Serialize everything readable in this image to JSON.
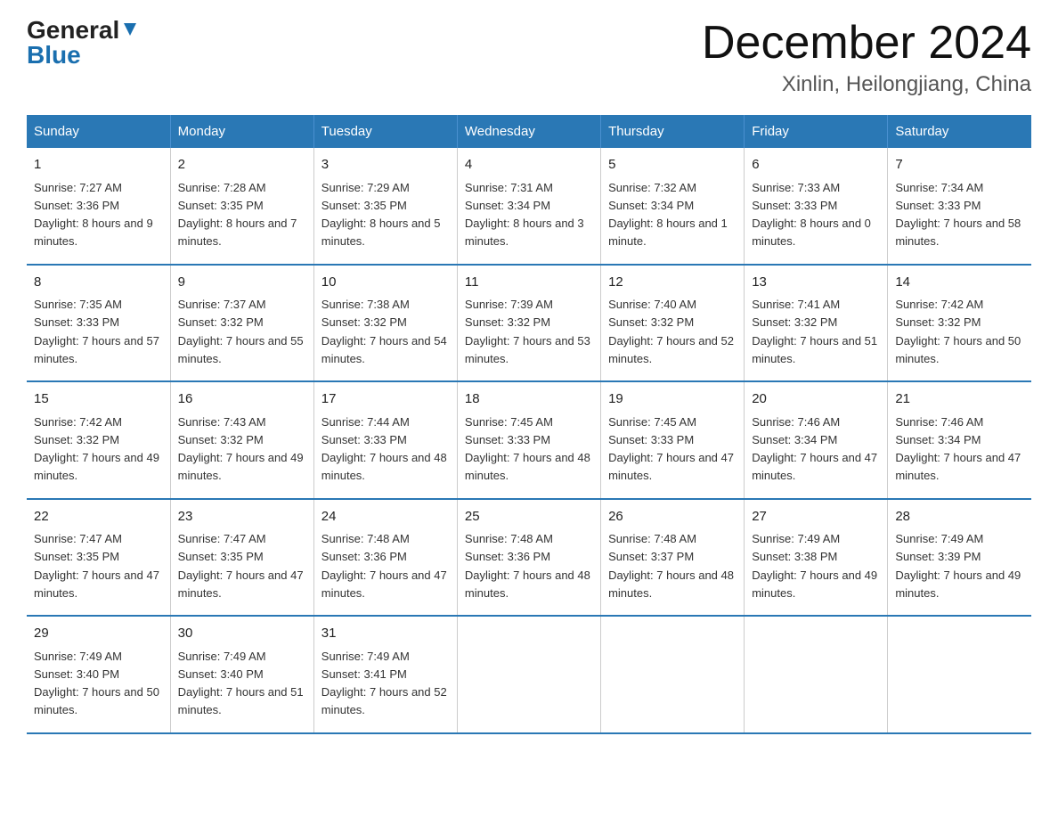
{
  "logo": {
    "general": "General",
    "blue": "Blue"
  },
  "title": "December 2024",
  "subtitle": "Xinlin, Heilongjiang, China",
  "days_of_week": [
    "Sunday",
    "Monday",
    "Tuesday",
    "Wednesday",
    "Thursday",
    "Friday",
    "Saturday"
  ],
  "weeks": [
    [
      {
        "day": "1",
        "sunrise": "7:27 AM",
        "sunset": "3:36 PM",
        "daylight": "8 hours and 9 minutes."
      },
      {
        "day": "2",
        "sunrise": "7:28 AM",
        "sunset": "3:35 PM",
        "daylight": "8 hours and 7 minutes."
      },
      {
        "day": "3",
        "sunrise": "7:29 AM",
        "sunset": "3:35 PM",
        "daylight": "8 hours and 5 minutes."
      },
      {
        "day": "4",
        "sunrise": "7:31 AM",
        "sunset": "3:34 PM",
        "daylight": "8 hours and 3 minutes."
      },
      {
        "day": "5",
        "sunrise": "7:32 AM",
        "sunset": "3:34 PM",
        "daylight": "8 hours and 1 minute."
      },
      {
        "day": "6",
        "sunrise": "7:33 AM",
        "sunset": "3:33 PM",
        "daylight": "8 hours and 0 minutes."
      },
      {
        "day": "7",
        "sunrise": "7:34 AM",
        "sunset": "3:33 PM",
        "daylight": "7 hours and 58 minutes."
      }
    ],
    [
      {
        "day": "8",
        "sunrise": "7:35 AM",
        "sunset": "3:33 PM",
        "daylight": "7 hours and 57 minutes."
      },
      {
        "day": "9",
        "sunrise": "7:37 AM",
        "sunset": "3:32 PM",
        "daylight": "7 hours and 55 minutes."
      },
      {
        "day": "10",
        "sunrise": "7:38 AM",
        "sunset": "3:32 PM",
        "daylight": "7 hours and 54 minutes."
      },
      {
        "day": "11",
        "sunrise": "7:39 AM",
        "sunset": "3:32 PM",
        "daylight": "7 hours and 53 minutes."
      },
      {
        "day": "12",
        "sunrise": "7:40 AM",
        "sunset": "3:32 PM",
        "daylight": "7 hours and 52 minutes."
      },
      {
        "day": "13",
        "sunrise": "7:41 AM",
        "sunset": "3:32 PM",
        "daylight": "7 hours and 51 minutes."
      },
      {
        "day": "14",
        "sunrise": "7:42 AM",
        "sunset": "3:32 PM",
        "daylight": "7 hours and 50 minutes."
      }
    ],
    [
      {
        "day": "15",
        "sunrise": "7:42 AM",
        "sunset": "3:32 PM",
        "daylight": "7 hours and 49 minutes."
      },
      {
        "day": "16",
        "sunrise": "7:43 AM",
        "sunset": "3:32 PM",
        "daylight": "7 hours and 49 minutes."
      },
      {
        "day": "17",
        "sunrise": "7:44 AM",
        "sunset": "3:33 PM",
        "daylight": "7 hours and 48 minutes."
      },
      {
        "day": "18",
        "sunrise": "7:45 AM",
        "sunset": "3:33 PM",
        "daylight": "7 hours and 48 minutes."
      },
      {
        "day": "19",
        "sunrise": "7:45 AM",
        "sunset": "3:33 PM",
        "daylight": "7 hours and 47 minutes."
      },
      {
        "day": "20",
        "sunrise": "7:46 AM",
        "sunset": "3:34 PM",
        "daylight": "7 hours and 47 minutes."
      },
      {
        "day": "21",
        "sunrise": "7:46 AM",
        "sunset": "3:34 PM",
        "daylight": "7 hours and 47 minutes."
      }
    ],
    [
      {
        "day": "22",
        "sunrise": "7:47 AM",
        "sunset": "3:35 PM",
        "daylight": "7 hours and 47 minutes."
      },
      {
        "day": "23",
        "sunrise": "7:47 AM",
        "sunset": "3:35 PM",
        "daylight": "7 hours and 47 minutes."
      },
      {
        "day": "24",
        "sunrise": "7:48 AM",
        "sunset": "3:36 PM",
        "daylight": "7 hours and 47 minutes."
      },
      {
        "day": "25",
        "sunrise": "7:48 AM",
        "sunset": "3:36 PM",
        "daylight": "7 hours and 48 minutes."
      },
      {
        "day": "26",
        "sunrise": "7:48 AM",
        "sunset": "3:37 PM",
        "daylight": "7 hours and 48 minutes."
      },
      {
        "day": "27",
        "sunrise": "7:49 AM",
        "sunset": "3:38 PM",
        "daylight": "7 hours and 49 minutes."
      },
      {
        "day": "28",
        "sunrise": "7:49 AM",
        "sunset": "3:39 PM",
        "daylight": "7 hours and 49 minutes."
      }
    ],
    [
      {
        "day": "29",
        "sunrise": "7:49 AM",
        "sunset": "3:40 PM",
        "daylight": "7 hours and 50 minutes."
      },
      {
        "day": "30",
        "sunrise": "7:49 AM",
        "sunset": "3:40 PM",
        "daylight": "7 hours and 51 minutes."
      },
      {
        "day": "31",
        "sunrise": "7:49 AM",
        "sunset": "3:41 PM",
        "daylight": "7 hours and 52 minutes."
      },
      null,
      null,
      null,
      null
    ]
  ]
}
